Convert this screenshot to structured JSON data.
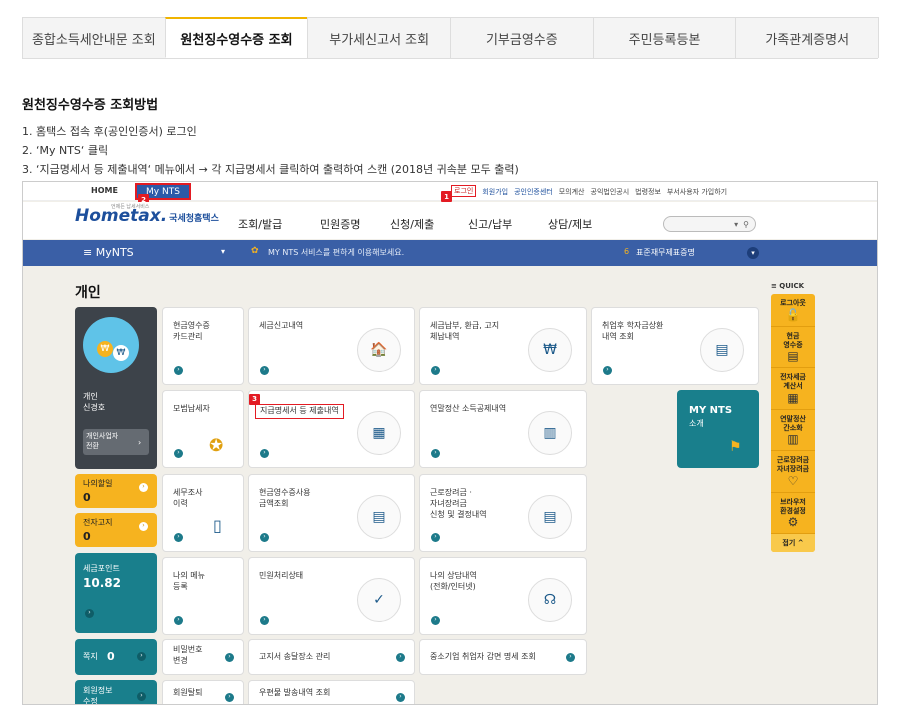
{
  "tabs": [
    {
      "label": "종합소득세안내문 조회",
      "active": false
    },
    {
      "label": "원천징수영수증 조회",
      "active": true
    },
    {
      "label": "부가세신고서 조회",
      "active": false
    },
    {
      "label": "기부금영수증",
      "active": false
    },
    {
      "label": "주민등록등본",
      "active": false
    },
    {
      "label": "가족관계증명서",
      "active": false
    }
  ],
  "howto": {
    "title": "원천징수영수증 조회방법",
    "steps": [
      "1. 홈택스 접속 후(공인인증서) 로그인",
      "2. ‘My NTS‘ 클릭",
      "3. ‘지급명세서 등 제출내역‘ 메뉴에서 → 각 지급명세서 클릭하여 출력하여 스캔 (2018년 귀속분 모두 출력)"
    ]
  },
  "shot": {
    "topbar": {
      "home": "HOME",
      "mynts": "My NTS",
      "login": "로그인",
      "links": [
        "회원가입",
        "공인인증센터",
        "모의계산",
        "공익법인공시",
        "법령정보",
        "부서사용자 가입하기"
      ],
      "badges": [
        "1",
        "2",
        "3"
      ]
    },
    "logo": {
      "main": "Hometax.",
      "sub": "국세청홈택스",
      "tagline": "언제든 납세서비스"
    },
    "menu": [
      "조회/발급",
      "민원증명",
      "신청/제출",
      "신고/납부",
      "상담/제보"
    ],
    "search_arrow": "▾",
    "search_icon": "search-icon",
    "bluebar": {
      "label": "≡  MyNTS",
      "arrow": "▾",
      "message": "MY NTS 서비스를 편하게 이용해보세요.",
      "right": "표준재무제표증명",
      "right_num": "6"
    },
    "section_title": "개인",
    "profile": {
      "name": "개인\n신경호",
      "switch": "개인사업자\n전환",
      "switch_arrow": "›"
    },
    "side_blocks": [
      {
        "label": "나의할일",
        "value": "0"
      },
      {
        "label": "전자고지",
        "value": "0"
      },
      {
        "label": "세금포인트",
        "value": "10.82"
      },
      {
        "label": "쪽지",
        "value": "0"
      },
      {
        "label": "회원정보\n수정",
        "value": ""
      }
    ],
    "cards": [
      "현금영수증\n카드관리",
      "세금신고내역",
      "세금납부, 환급, 고지\n체납내역",
      "취업후 학자금상환\n내역 조회",
      "모범납세자",
      "지급명세서 등 제출내역",
      "연말정산 소득공제내역",
      "세무조사\n이력",
      "현금영수증사용\n금액조회",
      "근로장려금 ·\n자녀장려금\n신청 및 결정내역",
      "나의 메뉴\n등록",
      "민원처리상태",
      "나의 상담내역\n(전화/인터넷)",
      "비밀번호\n변경",
      "고지서 송달장소 관리",
      "중소기업 취업자 감면 명세 조회",
      "회원탈퇴",
      "우편물 발송내역 조회"
    ],
    "mynts_intro": {
      "title": "MY NTS",
      "sub": "소개"
    },
    "quick": {
      "head": "≡ QUICK",
      "items": [
        "로그아웃",
        "현금\n영수증",
        "전자세금\n계산서",
        "연말정산\n간소화",
        "근로장려금\n자녀장려금",
        "브라우저\n환경설정"
      ],
      "close": "접기 ^"
    }
  }
}
